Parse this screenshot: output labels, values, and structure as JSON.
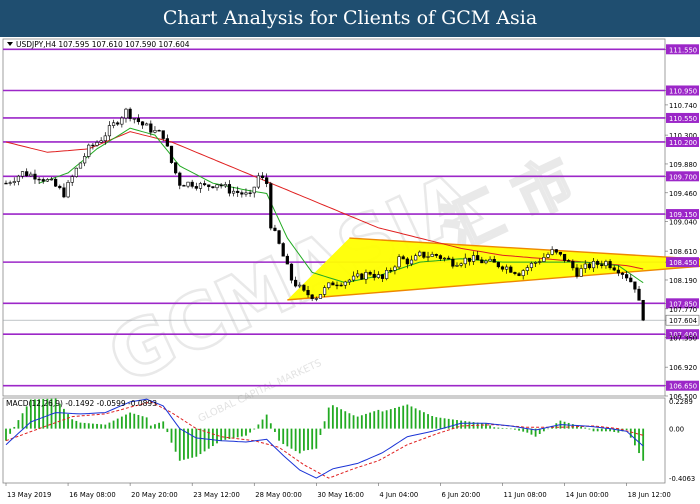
{
  "header": {
    "title": "Chart Analysis for Clients of GCM Asia"
  },
  "watermark": {
    "brand": "GCMASIA",
    "chinese": "汇 市",
    "subtitle": "GLOBAL CAPITAL MARKETS"
  },
  "chart_data": [
    {
      "type": "candlestick",
      "title": "USDJPY,H4  107.595  107.610  107.590  107.604",
      "symbol": "USDJPY,H4",
      "ohlc": {
        "open": 107.595,
        "high": 107.61,
        "low": 107.59,
        "close": 107.604
      },
      "current_price": 107.604,
      "ylim": [
        106.5,
        111.7
      ],
      "y_ticks": [
        111.55,
        110.95,
        110.74,
        110.55,
        110.3,
        110.2,
        109.88,
        109.7,
        109.46,
        109.15,
        109.04,
        108.61,
        108.45,
        108.19,
        107.85,
        107.77,
        107.604,
        107.4,
        107.35,
        106.92,
        106.65,
        106.5
      ],
      "y_tick_labels": [
        "111.550",
        "110.950",
        "110.740",
        "110.550",
        "110.300",
        "110.200",
        "109.880",
        "109.700",
        "109.460",
        "109.150",
        "109.040",
        "108.610",
        "108.450",
        "108.190",
        "107.850",
        "107.770",
        "107.604",
        "107.400",
        "107.350",
        "106.920",
        "106.650",
        "106.500"
      ],
      "levels": [
        111.55,
        110.95,
        110.55,
        110.2,
        109.7,
        109.15,
        108.45,
        107.85,
        107.4,
        106.65
      ],
      "x_labels": [
        "13 May 2019",
        "16 May 08:00",
        "20 May 20:00",
        "23 May 12:00",
        "28 May 00:00",
        "30 May 16:00",
        "4 Jun 04:00",
        "6 Jun 20:00",
        "11 Jun 08:00",
        "14 Jun 00:00",
        "18 Jun 12:00"
      ],
      "x_label_bars": [
        0,
        15,
        30,
        45,
        60,
        75,
        90,
        105,
        120,
        135,
        150
      ],
      "bar_count": 160,
      "price_waypoints": [
        [
          0,
          109.6
        ],
        [
          4,
          109.75
        ],
        [
          8,
          109.7
        ],
        [
          11,
          109.6
        ],
        [
          14,
          109.45
        ],
        [
          17,
          109.8
        ],
        [
          20,
          110.1
        ],
        [
          23,
          110.25
        ],
        [
          26,
          110.45
        ],
        [
          29,
          110.65
        ],
        [
          31,
          110.55
        ],
        [
          33,
          110.45
        ],
        [
          36,
          110.35
        ],
        [
          38,
          110.3
        ],
        [
          40,
          109.9
        ],
        [
          42,
          109.6
        ],
        [
          45,
          109.6
        ],
        [
          48,
          109.55
        ],
        [
          51,
          109.6
        ],
        [
          54,
          109.5
        ],
        [
          57,
          109.45
        ],
        [
          59,
          109.4
        ],
        [
          61,
          109.7
        ],
        [
          63,
          109.6
        ],
        [
          64,
          109.0
        ],
        [
          66,
          108.7
        ],
        [
          69,
          108.2
        ],
        [
          72,
          108.0
        ],
        [
          75,
          107.95
        ],
        [
          79,
          108.15
        ],
        [
          84,
          108.2
        ],
        [
          88,
          108.3
        ],
        [
          91,
          108.2
        ],
        [
          95,
          108.5
        ],
        [
          98,
          108.45
        ],
        [
          100,
          108.55
        ],
        [
          104,
          108.55
        ],
        [
          108,
          108.45
        ],
        [
          112,
          108.5
        ],
        [
          116,
          108.45
        ],
        [
          120,
          108.4
        ],
        [
          124,
          108.3
        ],
        [
          128,
          108.45
        ],
        [
          132,
          108.6
        ],
        [
          135,
          108.5
        ],
        [
          138,
          108.3
        ],
        [
          141,
          108.4
        ],
        [
          145,
          108.45
        ],
        [
          148,
          108.35
        ],
        [
          150,
          108.25
        ],
        [
          152,
          108.1
        ],
        [
          153,
          107.85
        ],
        [
          154,
          107.604
        ]
      ],
      "ma_red_waypoints": [
        [
          0,
          110.2
        ],
        [
          10,
          110.05
        ],
        [
          20,
          110.1
        ],
        [
          30,
          110.35
        ],
        [
          40,
          110.2
        ],
        [
          50,
          109.95
        ],
        [
          60,
          109.7
        ],
        [
          70,
          109.45
        ],
        [
          80,
          109.2
        ],
        [
          90,
          108.95
        ],
        [
          100,
          108.8
        ],
        [
          110,
          108.65
        ],
        [
          120,
          108.55
        ],
        [
          130,
          108.5
        ],
        [
          140,
          108.45
        ],
        [
          150,
          108.4
        ],
        [
          154,
          108.35
        ]
      ],
      "ma_green_waypoints": [
        [
          8,
          109.6
        ],
        [
          15,
          109.75
        ],
        [
          22,
          110.1
        ],
        [
          30,
          110.4
        ],
        [
          36,
          110.3
        ],
        [
          42,
          109.85
        ],
        [
          50,
          109.6
        ],
        [
          58,
          109.5
        ],
        [
          63,
          109.45
        ],
        [
          68,
          108.8
        ],
        [
          74,
          108.3
        ],
        [
          82,
          108.15
        ],
        [
          90,
          108.25
        ],
        [
          100,
          108.45
        ],
        [
          110,
          108.5
        ],
        [
          120,
          108.45
        ],
        [
          130,
          108.45
        ],
        [
          140,
          108.45
        ],
        [
          148,
          108.4
        ],
        [
          154,
          108.15
        ]
      ],
      "triangle": {
        "upper": [
          [
            83,
            108.8
          ],
          [
            180,
            108.45
          ]
        ],
        "lower": [
          [
            68,
            107.9
          ],
          [
            180,
            108.45
          ]
        ],
        "apex_price": 108.45
      },
      "colors": {
        "level": "#9c27c8",
        "ma_red": "#e02020",
        "ma_green": "#22aa22",
        "triangle_fill": "#ffff00",
        "triangle_edge": "#ee8800",
        "candle": "#000000"
      }
    },
    {
      "type": "macd",
      "title": "MACD(12,26,9) -0.1492 -0.0599 -0.0893",
      "params": "MACD(12,26,9)",
      "values": {
        "macd": -0.1492,
        "signal": -0.0599,
        "histogram": -0.0893
      },
      "ylim": [
        -0.4063,
        0.2289
      ],
      "y_tick_labels": [
        "0.2289",
        "0.00",
        "-0.4063"
      ],
      "macd_waypoints": [
        [
          0,
          -0.12
        ],
        [
          6,
          0.05
        ],
        [
          12,
          0.12
        ],
        [
          18,
          0.11
        ],
        [
          24,
          0.12
        ],
        [
          30,
          0.2
        ],
        [
          34,
          0.22
        ],
        [
          38,
          0.17
        ],
        [
          42,
          0.0
        ],
        [
          46,
          -0.07
        ],
        [
          52,
          -0.09
        ],
        [
          58,
          -0.1
        ],
        [
          63,
          -0.08
        ],
        [
          67,
          -0.2
        ],
        [
          71,
          -0.31
        ],
        [
          75,
          -0.37
        ],
        [
          79,
          -0.3
        ],
        [
          85,
          -0.26
        ],
        [
          91,
          -0.18
        ],
        [
          97,
          -0.06
        ],
        [
          103,
          -0.02
        ],
        [
          110,
          0.04
        ],
        [
          116,
          0.04
        ],
        [
          122,
          0.02
        ],
        [
          128,
          -0.01
        ],
        [
          134,
          0.03
        ],
        [
          140,
          0.02
        ],
        [
          146,
          0.0
        ],
        [
          150,
          -0.02
        ],
        [
          154,
          -0.13
        ]
      ],
      "signal_waypoints": [
        [
          0,
          -0.09
        ],
        [
          8,
          0.0
        ],
        [
          16,
          0.09
        ],
        [
          24,
          0.11
        ],
        [
          30,
          0.16
        ],
        [
          35,
          0.2
        ],
        [
          40,
          0.12
        ],
        [
          46,
          0.0
        ],
        [
          52,
          -0.06
        ],
        [
          60,
          -0.09
        ],
        [
          66,
          -0.14
        ],
        [
          72,
          -0.27
        ],
        [
          78,
          -0.37
        ],
        [
          84,
          -0.3
        ],
        [
          90,
          -0.24
        ],
        [
          97,
          -0.12
        ],
        [
          104,
          -0.04
        ],
        [
          110,
          0.02
        ],
        [
          118,
          0.03
        ],
        [
          126,
          0.01
        ],
        [
          134,
          0.01
        ],
        [
          142,
          0.02
        ],
        [
          148,
          0.0
        ],
        [
          154,
          -0.05
        ]
      ],
      "colors": {
        "macd": "#1a33d6",
        "signal": "#e02020",
        "histogram": "#22aa22"
      }
    }
  ]
}
